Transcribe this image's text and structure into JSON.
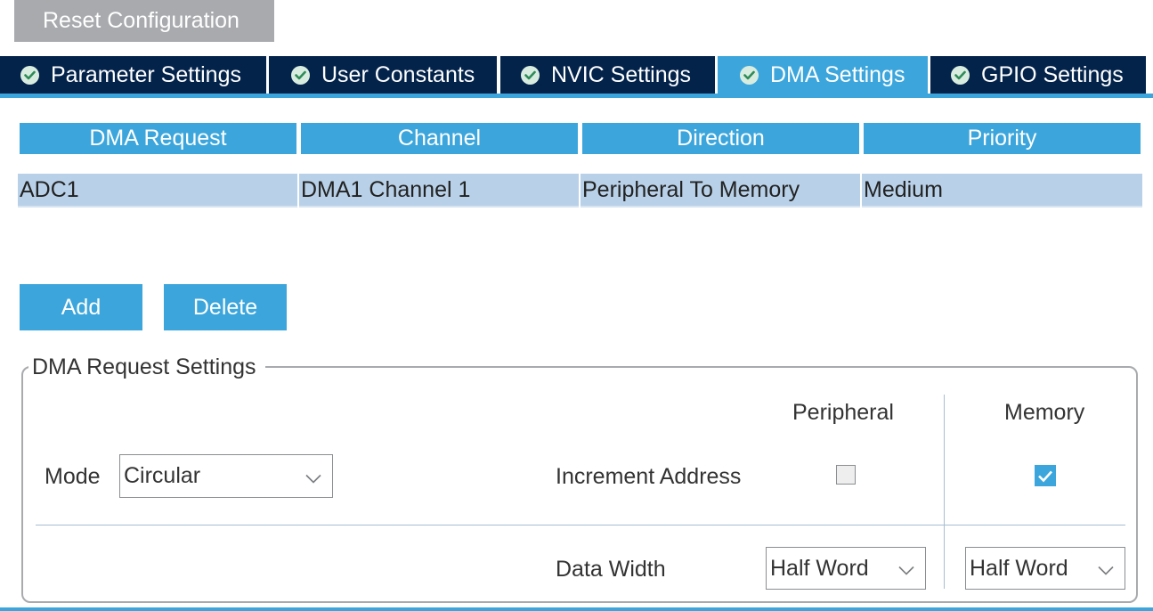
{
  "toolbar": {
    "reset_label": "Reset Configuration"
  },
  "tabs": [
    {
      "label": "Parameter Settings",
      "icon": "check-circle-icon",
      "active": false
    },
    {
      "label": "User Constants",
      "icon": "check-circle-icon",
      "active": false
    },
    {
      "label": "NVIC Settings",
      "icon": "check-circle-icon",
      "active": false
    },
    {
      "label": "DMA Settings",
      "icon": "check-circle-icon",
      "active": true
    },
    {
      "label": "GPIO Settings",
      "icon": "check-circle-icon",
      "active": false
    }
  ],
  "table": {
    "headers": [
      "DMA Request",
      "Channel",
      "Direction",
      "Priority"
    ],
    "rows": [
      [
        "ADC1",
        "DMA1 Channel 1",
        "Peripheral To Memory",
        "Medium"
      ]
    ]
  },
  "actions": {
    "add_label": "Add",
    "delete_label": "Delete"
  },
  "settings": {
    "legend": "DMA Request Settings",
    "mode_label": "Mode",
    "mode_value": "Circular",
    "peripheral_header": "Peripheral",
    "memory_header": "Memory",
    "increment_label": "Increment Address",
    "increment_peripheral": false,
    "increment_memory": true,
    "data_width_label": "Data Width",
    "data_width_peripheral": "Half Word",
    "data_width_memory": "Half Word"
  },
  "colors": {
    "tab_bg": "#03234b",
    "accent": "#3ca6dc",
    "row_selected": "#b9d1e8",
    "reset_bg": "#a8aaad"
  }
}
